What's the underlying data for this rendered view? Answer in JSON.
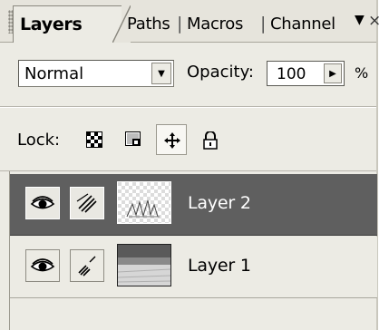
{
  "tabs": [
    {
      "label": "Layers",
      "active": true
    },
    {
      "label": "Paths",
      "active": false
    },
    {
      "label": "Macros",
      "active": false
    },
    {
      "label": "Channel",
      "active": false
    }
  ],
  "tab_separator": "|",
  "tab_menu_glyph": "▼",
  "tab_close_glyph": "×",
  "blend": {
    "value": "Normal",
    "arrow": "▼"
  },
  "opacity": {
    "label": "Opacity:",
    "value": "100",
    "arrow": "▶",
    "unit": "%"
  },
  "lock": {
    "label": "Lock:",
    "buttons": [
      {
        "name": "lock-transparency",
        "icon": "checker-icon",
        "pressed": false
      },
      {
        "name": "lock-image",
        "icon": "image-lock-icon",
        "pressed": false
      },
      {
        "name": "lock-position",
        "icon": "move-arrows-icon",
        "pressed": true
      },
      {
        "name": "lock-all",
        "icon": "padlock-icon",
        "pressed": false
      }
    ]
  },
  "layers": [
    {
      "name": "Layer 2",
      "selected": true,
      "visible": true,
      "thumbnail": "sketch-transparent"
    },
    {
      "name": "Layer 1",
      "selected": false,
      "visible": true,
      "thumbnail": "snow-landscape"
    }
  ],
  "colors": {
    "panel_bg": "#ecebe4",
    "selected_row": "#5f5f5f",
    "selected_text": "#ffffff"
  }
}
